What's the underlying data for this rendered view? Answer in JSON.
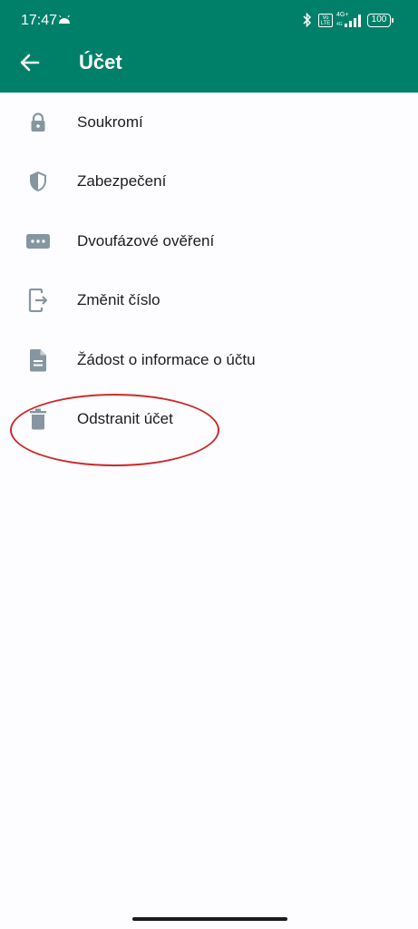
{
  "status_bar": {
    "time": "17:47",
    "network_label": "4G+",
    "network_sub": "4G",
    "volte_label": "Vo LTE",
    "battery": "100"
  },
  "app_bar": {
    "title": "Účet"
  },
  "menu": {
    "items": [
      {
        "label": "Soukromí",
        "icon": "lock-icon"
      },
      {
        "label": "Zabezpečení",
        "icon": "shield-icon"
      },
      {
        "label": "Dvoufázové ověření",
        "icon": "dots-icon"
      },
      {
        "label": "Změnit číslo",
        "icon": "change-number-icon"
      },
      {
        "label": "Žádost o informace o účtu",
        "icon": "document-icon"
      },
      {
        "label": "Odstranit účet",
        "icon": "trash-icon"
      }
    ]
  },
  "colors": {
    "app_bar": "#008069",
    "icon": "#8696a0",
    "annotation": "#cc2a2a"
  }
}
